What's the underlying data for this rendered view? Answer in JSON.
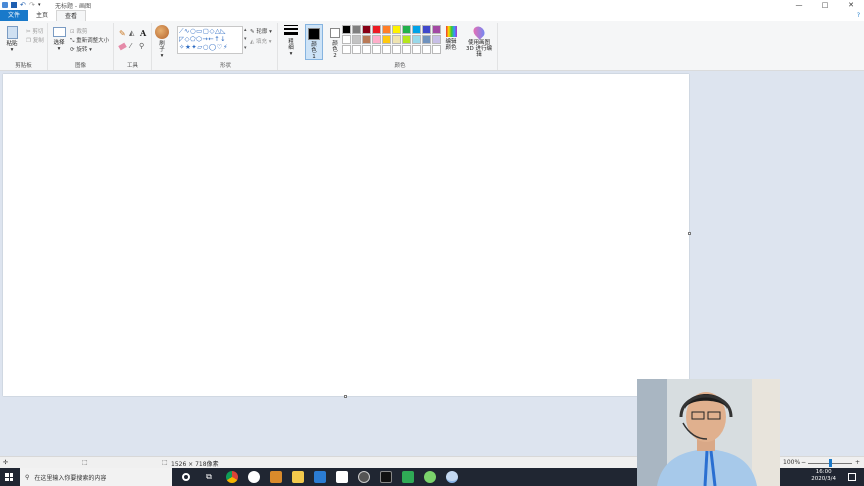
{
  "window": {
    "title": "无标题 - 画图",
    "minimize": "—",
    "maximize": "□",
    "close": "✕"
  },
  "tabs": [
    {
      "label": "文件"
    },
    {
      "label": "主页"
    },
    {
      "label": "查看"
    }
  ],
  "clipboard": {
    "paste": "粘贴",
    "cut": "剪切",
    "copy": "复制",
    "group": "剪贴板"
  },
  "image": {
    "select": "选择",
    "crop": "裁剪",
    "resize": "重新调整大小",
    "rotate": "旋转",
    "group": "图像"
  },
  "tools": {
    "text_tool": "A",
    "group": "工具"
  },
  "brushes": {
    "label": "刷子"
  },
  "shapes": {
    "outline": "轮廓",
    "fill": "填充",
    "group": "形状"
  },
  "size": {
    "label": "粗细"
  },
  "colors": {
    "color1": "颜色 1",
    "color2": "颜色 2",
    "edit_colors": "编辑颜色",
    "paint3d": "使用画图 3D 进行编辑",
    "group": "颜色",
    "palette": [
      "#000000",
      "#7f7f7f",
      "#880015",
      "#ed1c24",
      "#ff7f27",
      "#fff200",
      "#22b14c",
      "#00a2e8",
      "#3f48cc",
      "#a349a4",
      "#ffffff",
      "#c3c3c3",
      "#b97a57",
      "#ffaec9",
      "#ffc90e",
      "#efe4b0",
      "#b5e61d",
      "#99d9ea",
      "#7092be",
      "#c8bfe7",
      "#ffffff",
      "#ffffff",
      "#ffffff",
      "#ffffff",
      "#ffffff",
      "#ffffff",
      "#ffffff",
      "#ffffff",
      "#ffffff",
      "#ffffff"
    ]
  },
  "status": {
    "dimensions": "1526 × 718像素",
    "zoom": "100%",
    "zoom_out": "−",
    "zoom_in": "+"
  },
  "taskbar": {
    "search_placeholder": "在这里输入你要搜索的内容",
    "time": "16:00",
    "date": "2020/3/4"
  }
}
